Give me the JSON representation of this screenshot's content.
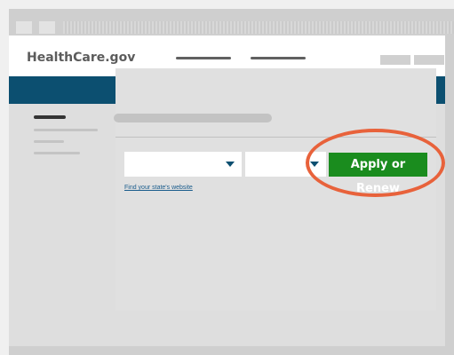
{
  "header": {
    "logo": "HealthCare.gov"
  },
  "form": {
    "apply_button_label": "Apply or Renew",
    "state_link": "Find your state's website"
  },
  "colors": {
    "brand_band": "#0c4f70",
    "apply_button": "#1a8c1e",
    "highlight_ring": "#e8623b"
  },
  "icons": {
    "dropdown_caret": "chevron-down-icon"
  }
}
